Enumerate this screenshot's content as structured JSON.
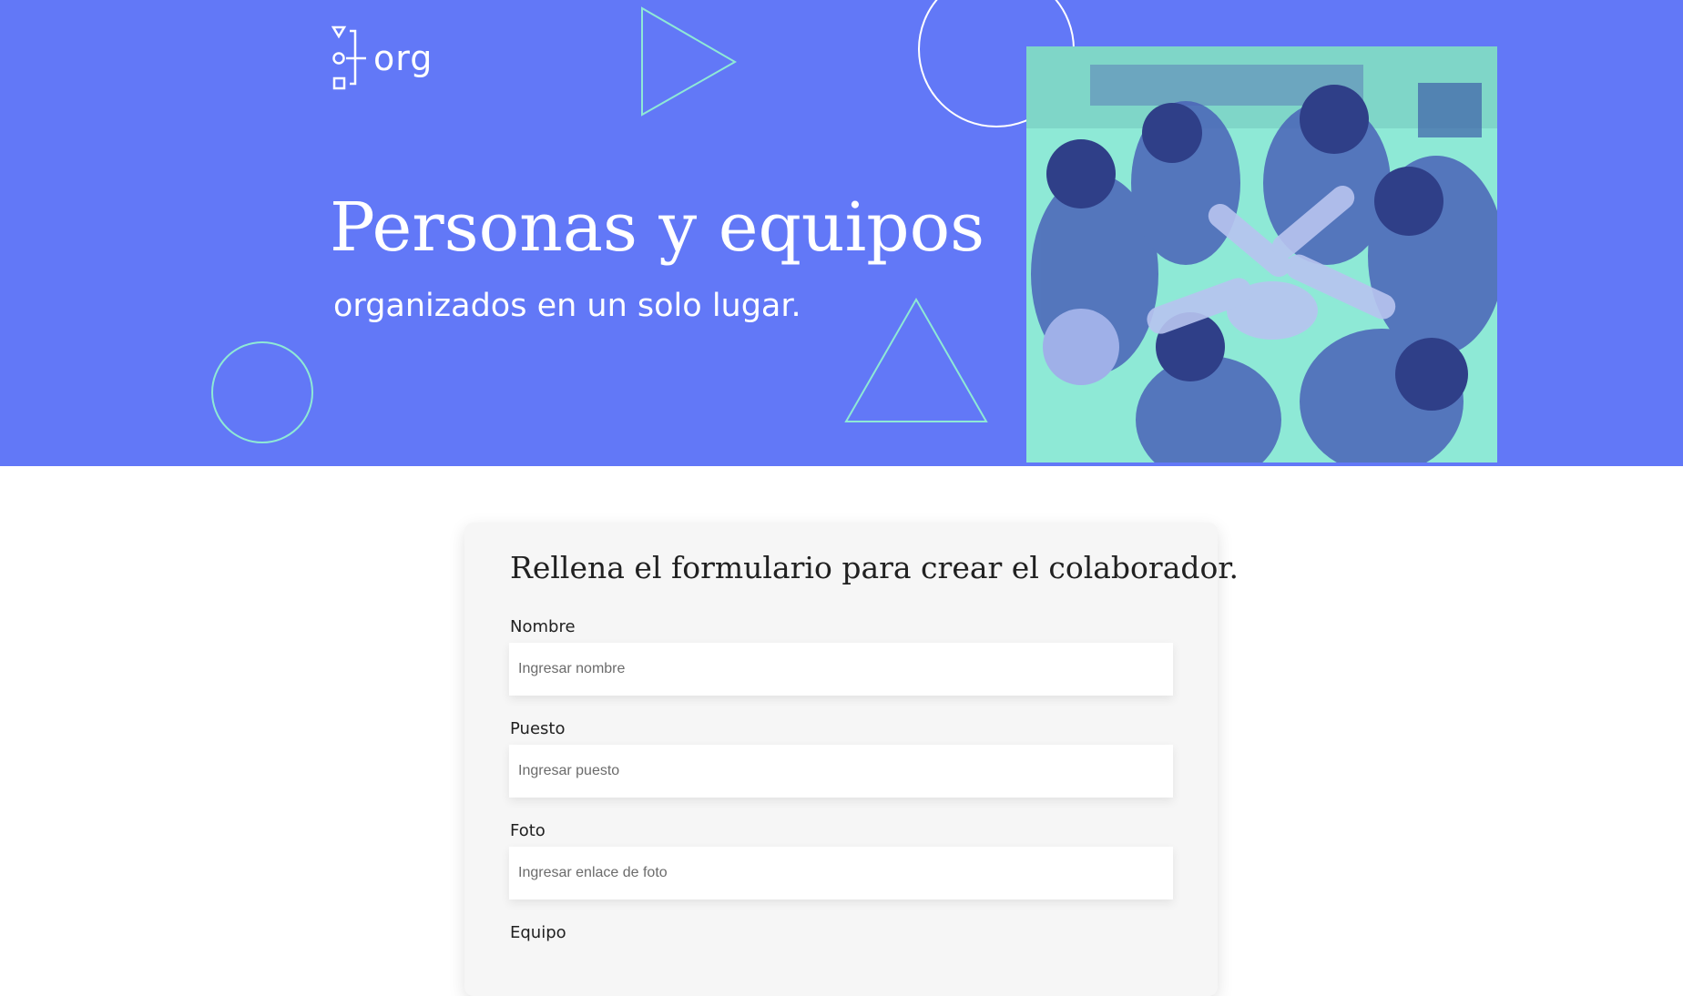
{
  "header": {
    "logo_text": "org",
    "title": "Personas y equipos",
    "subtitle": "organizados en un solo lugar.",
    "background_color": "#6278f7",
    "accent_color": "#8ee9d6"
  },
  "form": {
    "title": "Rellena el formulario para crear el colaborador.",
    "fields": [
      {
        "label": "Nombre",
        "placeholder": "Ingresar nombre"
      },
      {
        "label": "Puesto",
        "placeholder": "Ingresar puesto"
      },
      {
        "label": "Foto",
        "placeholder": "Ingresar enlace de foto"
      },
      {
        "label": "Equipo"
      }
    ]
  }
}
